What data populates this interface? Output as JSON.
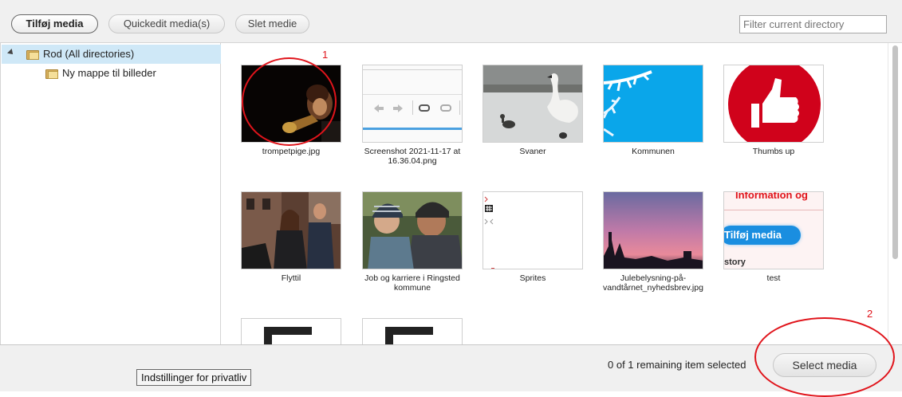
{
  "toolbar": {
    "add_media": "Tilføj media",
    "quickedit": "Quickedit media(s)",
    "delete": "Slet medie",
    "filter_placeholder": "Filter current directory"
  },
  "sidebar": {
    "items": [
      {
        "label": "Rod (All directories)",
        "selected": true,
        "icon": "folder-icon"
      },
      {
        "label": "Ny mappe til billeder",
        "selected": false,
        "icon": "folder-icon"
      }
    ]
  },
  "media": [
    {
      "caption": "trompetpige.jpg",
      "kind": "photo-trumpet"
    },
    {
      "caption": "Screenshot 2021-11-17 at 16.36.04.png",
      "kind": "screenshot-editor"
    },
    {
      "caption": "Svaner",
      "kind": "photo-swans"
    },
    {
      "caption": "Kommunen",
      "kind": "photo-snowy-branch"
    },
    {
      "caption": "Thumbs up",
      "kind": "thumbs-up-icon"
    },
    {
      "caption": "Flyttil",
      "kind": "photo-people-street"
    },
    {
      "caption": "Job og karriere i Ringsted kommune",
      "kind": "photo-father-child"
    },
    {
      "caption": "Sprites",
      "kind": "sprites"
    },
    {
      "caption": "Julebelysning-på-vandtårnet_nyhedsbrev.jpg",
      "kind": "photo-sunset"
    },
    {
      "caption": "test",
      "kind": "screenshot-button"
    },
    {
      "caption": "",
      "kind": "file-icon"
    },
    {
      "caption": "",
      "kind": "file-icon"
    }
  ],
  "test_thumb": {
    "heading_fragment": "Information og",
    "button_text": "Tilføj media",
    "bottom_fragment": "story"
  },
  "footer": {
    "remaining": "0 of 1 remaining item selected",
    "select_media": "Select media",
    "privacy": "Indstillinger for privatliv"
  },
  "annotations": [
    {
      "number": "1"
    },
    {
      "number": "2"
    }
  ],
  "colors": {
    "toolbar_bg": "#f0f0f0",
    "selected_row": "#cfe8f7",
    "annotation_red": "#e0141b",
    "thumbs_red": "#d0021b",
    "select_button": "#e6e6e6"
  }
}
